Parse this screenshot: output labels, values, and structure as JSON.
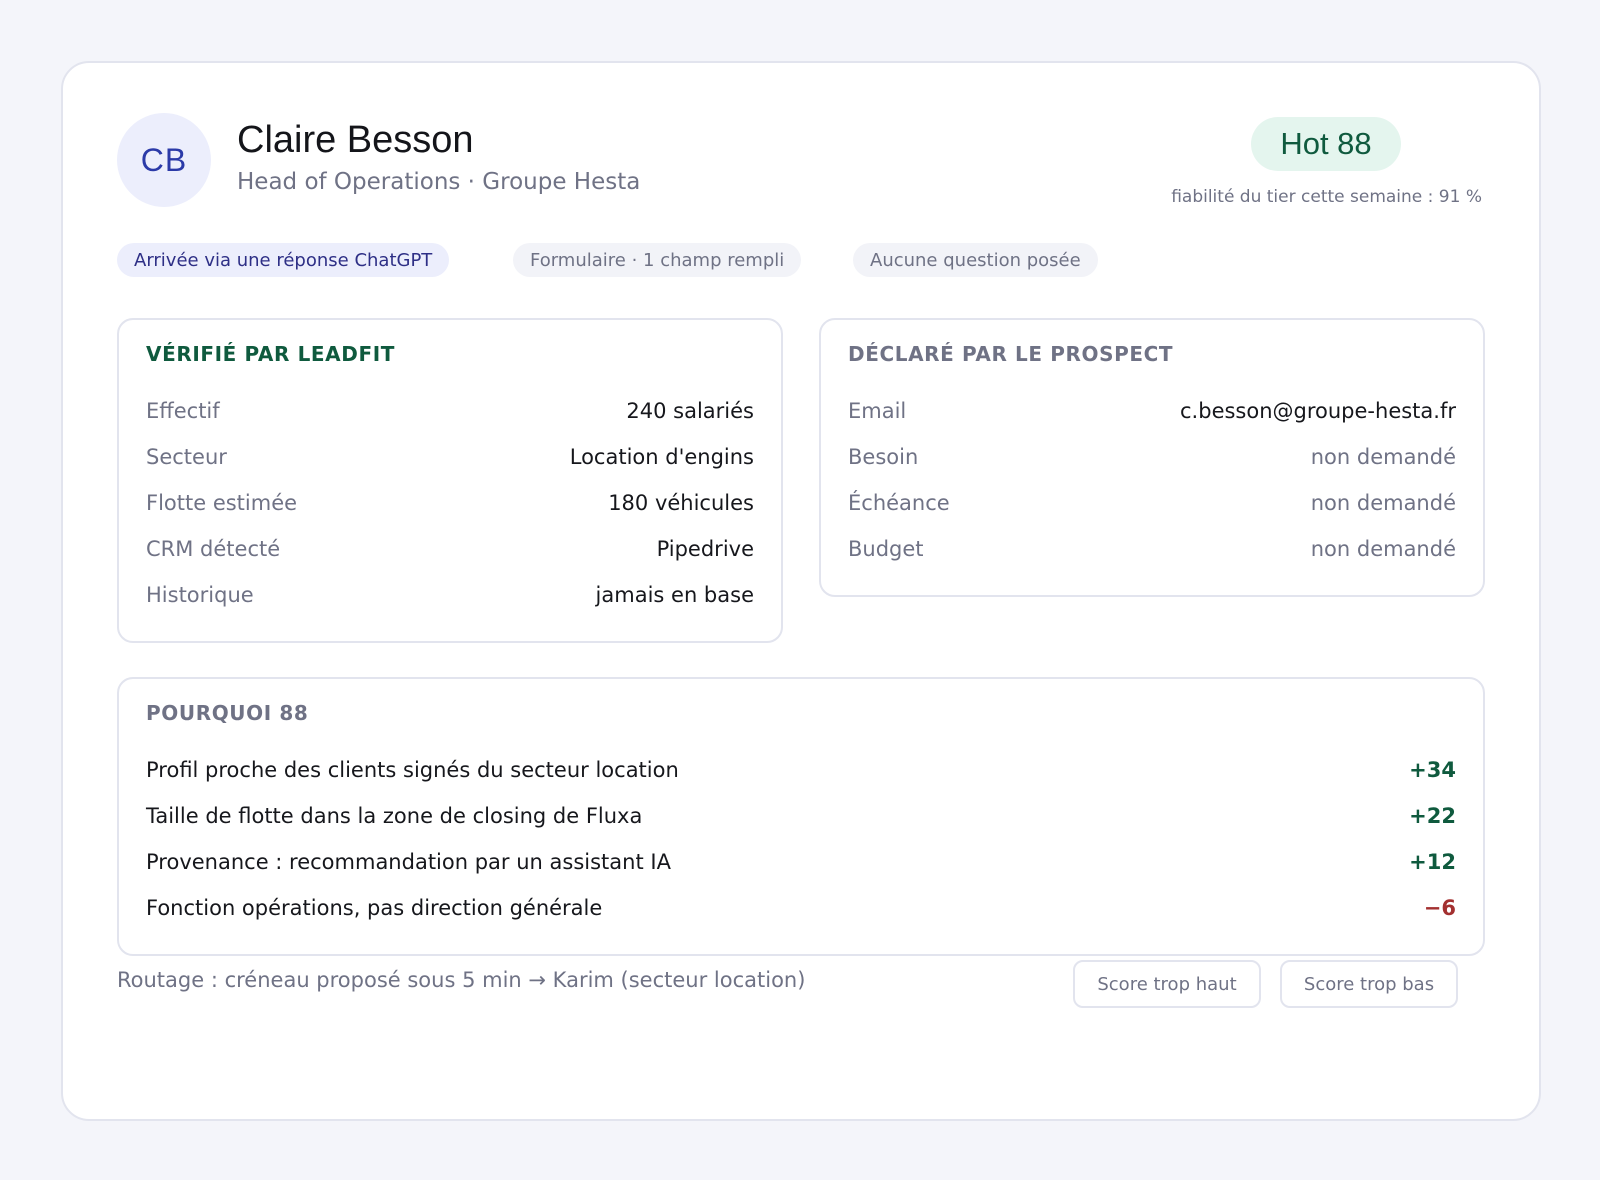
{
  "profile": {
    "initials": "CB",
    "name": "Claire Besson",
    "role": "Head of Operations · Groupe Hesta"
  },
  "score": {
    "badge": "Hot 88",
    "reliability": "fiabilité du tier cette semaine : 91 %"
  },
  "chips": [
    "Arrivée via une réponse ChatGPT",
    "Formulaire · 1 champ rempli",
    "Aucune question posée"
  ],
  "verified": {
    "title": "VÉRIFIÉ PAR LEADFIT",
    "rows": [
      {
        "label": "Effectif",
        "value": "240 salariés"
      },
      {
        "label": "Secteur",
        "value": "Location d'engins"
      },
      {
        "label": "Flotte estimée",
        "value": "180 véhicules"
      },
      {
        "label": "CRM détecté",
        "value": "Pipedrive"
      },
      {
        "label": "Historique",
        "value": "jamais en base"
      }
    ]
  },
  "declared": {
    "title": "DÉCLARÉ PAR LE PROSPECT",
    "rows": [
      {
        "label": "Email",
        "value": "c.besson@groupe-hesta.fr"
      },
      {
        "label": "Besoin",
        "value": "non demandé"
      },
      {
        "label": "Échéance",
        "value": "non demandé"
      },
      {
        "label": "Budget",
        "value": "non demandé"
      }
    ]
  },
  "why": {
    "title": "POURQUOI 88",
    "rows": [
      {
        "label": "Profil proche des clients signés du secteur location",
        "value": "+34"
      },
      {
        "label": "Taille de flotte dans la zone de closing de Fluxa",
        "value": "+22"
      },
      {
        "label": "Provenance : recommandation par un assistant IA",
        "value": "+12"
      },
      {
        "label": "Fonction opérations, pas direction générale",
        "value": "−6"
      }
    ]
  },
  "footer": {
    "routing": "Routage : créneau proposé sous 5 min → Karim (secteur location)",
    "btn_high": "Score trop haut",
    "btn_low": "Score trop bas"
  },
  "colors": {
    "positive": "#0f5a3e",
    "negative": "#a33030",
    "accent": "#2b3aa8"
  }
}
